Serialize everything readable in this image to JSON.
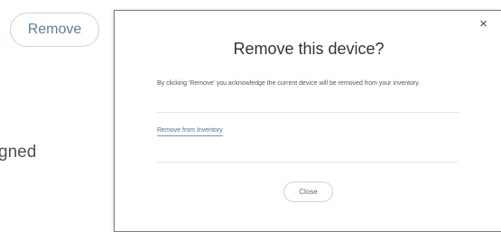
{
  "background": {
    "remove_button_label": "Remove",
    "partial_text": "gned"
  },
  "modal": {
    "close_glyph": "×",
    "title": "Remove this device?",
    "message": "By clicking 'Remove' you acknowledge the current device will be removed from your inventory.",
    "link_label": "Remove from Inventory",
    "close_button_label": "Close"
  }
}
